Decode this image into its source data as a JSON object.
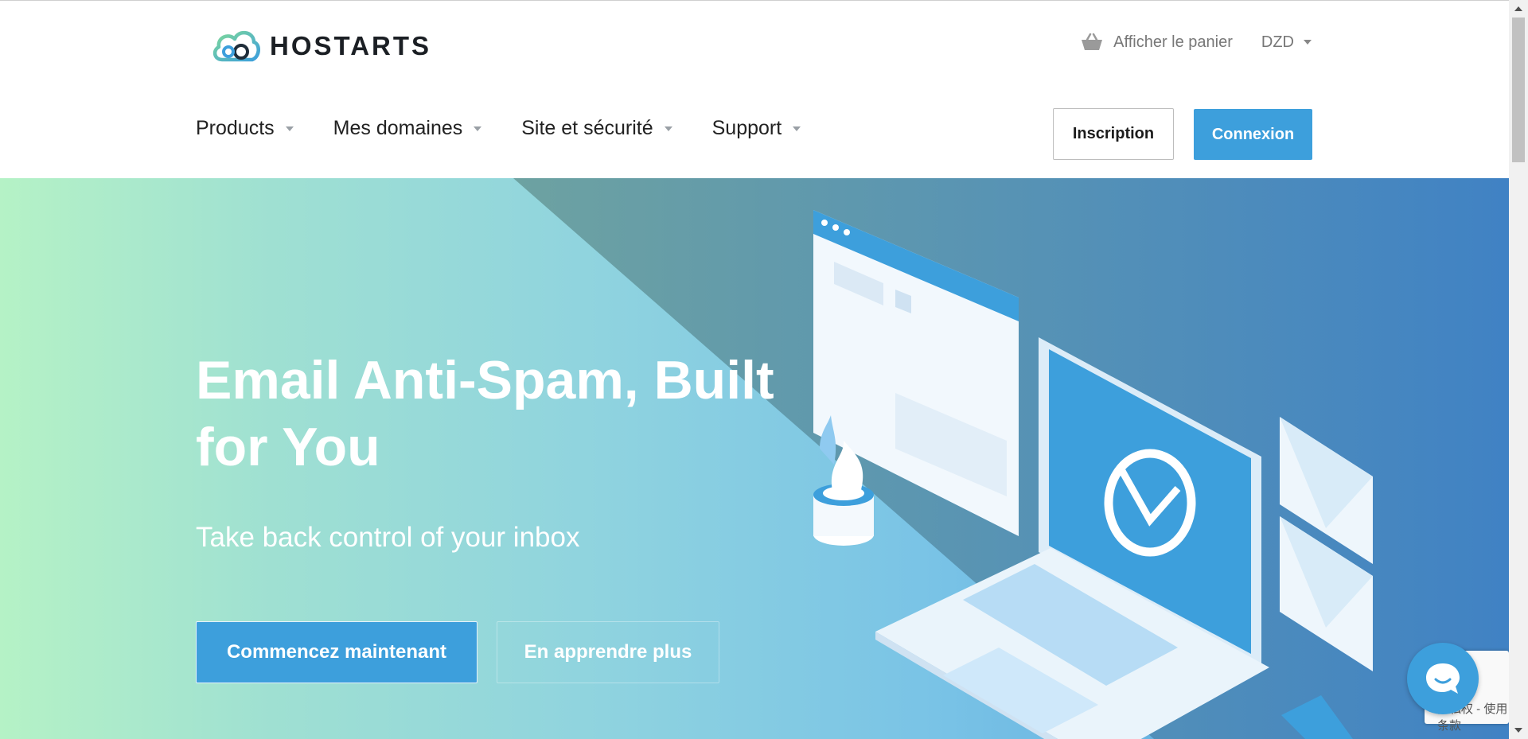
{
  "brand": {
    "name": "HOSTARTS"
  },
  "utility": {
    "cart_label": "Afficher le panier",
    "currency": "DZD"
  },
  "nav": {
    "items": [
      {
        "label": "Products"
      },
      {
        "label": "Mes domaines"
      },
      {
        "label": "Site et sécurité"
      },
      {
        "label": "Support"
      }
    ]
  },
  "auth": {
    "register_label": "Inscription",
    "login_label": "Connexion"
  },
  "hero": {
    "title": "Email Anti-Spam, Built for You",
    "subtitle": "Take back control of your inbox",
    "primary_cta": "Commencez maintenant",
    "secondary_cta": "En apprendre plus"
  },
  "recaptcha": {
    "text": "隐私权 - 使用条款"
  },
  "colors": {
    "accent": "#3d9fdc",
    "hero_left": "#b5f2c6",
    "hero_right": "#4a94d4",
    "text_dark": "#222222"
  },
  "icons": [
    "logo-icon",
    "basket-icon",
    "chevron-down-icon",
    "chat-icon"
  ]
}
